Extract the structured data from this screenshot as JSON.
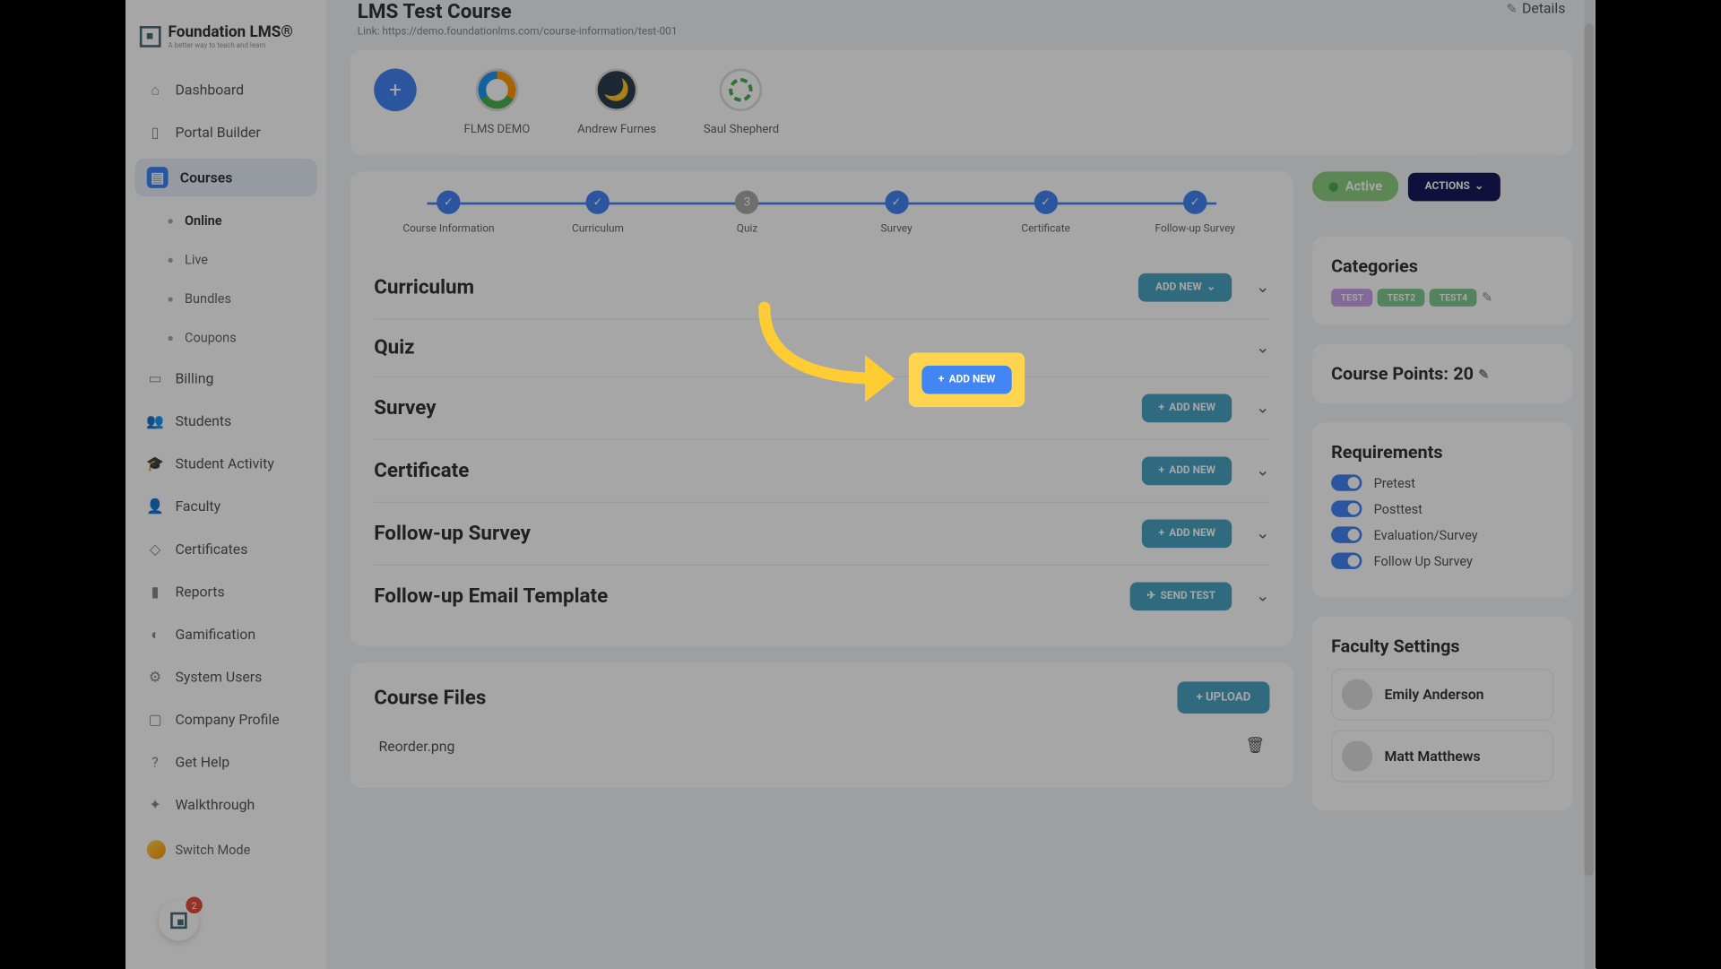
{
  "logo": {
    "name": "Foundation LMS®",
    "tagline": "A better way to teach and learn"
  },
  "sidebar": {
    "items": [
      {
        "label": "Dashboard",
        "icon": "home"
      },
      {
        "label": "Portal Builder",
        "icon": "build"
      },
      {
        "label": "Courses",
        "icon": "book",
        "active": true
      },
      {
        "label": "Billing",
        "icon": "card"
      },
      {
        "label": "Students",
        "icon": "group"
      },
      {
        "label": "Student Activity",
        "icon": "grad"
      },
      {
        "label": "Faculty",
        "icon": "person"
      },
      {
        "label": "Certificates",
        "icon": "cert"
      },
      {
        "label": "Reports",
        "icon": "chart"
      },
      {
        "label": "Gamification",
        "icon": "game"
      },
      {
        "label": "System Users",
        "icon": "admin"
      },
      {
        "label": "Company Profile",
        "icon": "company"
      },
      {
        "label": "Get Help",
        "icon": "help"
      },
      {
        "label": "Walkthrough",
        "icon": "walk"
      }
    ],
    "courses_sub": [
      {
        "label": "Online",
        "active": true
      },
      {
        "label": "Live"
      },
      {
        "label": "Bundles"
      },
      {
        "label": "Coupons"
      }
    ],
    "switch_mode": "Switch Mode",
    "chat_badge": "2"
  },
  "header": {
    "title": "LMS Test Course",
    "link_prefix": "Link: ",
    "link": "https://demo.foundationlms.com/course-information/test-001",
    "details": "Details"
  },
  "avatars": {
    "add": "+",
    "items": [
      {
        "label": "FLMS DEMO"
      },
      {
        "label": "Andrew Furnes"
      },
      {
        "label": "Saul Shepherd"
      }
    ]
  },
  "steps": [
    {
      "label": "Course Information",
      "done": true
    },
    {
      "label": "Curriculum",
      "done": true
    },
    {
      "label": "Quiz",
      "num": "3",
      "done": false
    },
    {
      "label": "Survey",
      "done": true
    },
    {
      "label": "Certificate",
      "done": true
    },
    {
      "label": "Follow-up Survey",
      "done": true
    }
  ],
  "sections": {
    "curriculum": {
      "title": "Curriculum",
      "btn": "ADD NEW"
    },
    "quiz": {
      "title": "Quiz",
      "btn": "ADD NEW"
    },
    "survey": {
      "title": "Survey",
      "btn": "ADD NEW"
    },
    "certificate": {
      "title": "Certificate",
      "btn": "ADD NEW"
    },
    "followup": {
      "title": "Follow-up Survey",
      "btn": "ADD NEW"
    },
    "email": {
      "title": "Follow-up Email Template",
      "btn": "SEND TEST"
    }
  },
  "files": {
    "title": "Course Files",
    "upload": "UPLOAD",
    "items": [
      {
        "name": "Reorder.png"
      }
    ]
  },
  "side": {
    "status": "Active",
    "actions": "ACTIONS",
    "categories": {
      "heading": "Categories",
      "tags": [
        "TEST",
        "TEST2",
        "TEST4"
      ]
    },
    "points": {
      "label": "Course Points: ",
      "value": "20"
    },
    "requirements": {
      "heading": "Requirements",
      "items": [
        "Pretest",
        "Posttest",
        "Evaluation/Survey",
        "Follow Up Survey"
      ]
    },
    "faculty": {
      "heading": "Faculty Settings",
      "items": [
        "Emily Anderson",
        "Matt Matthews"
      ]
    }
  },
  "icons": {
    "plus": "+",
    "chevron_down": "⌄",
    "pencil": "✎",
    "check": "✓",
    "trash": "🗑",
    "send": "✈"
  }
}
